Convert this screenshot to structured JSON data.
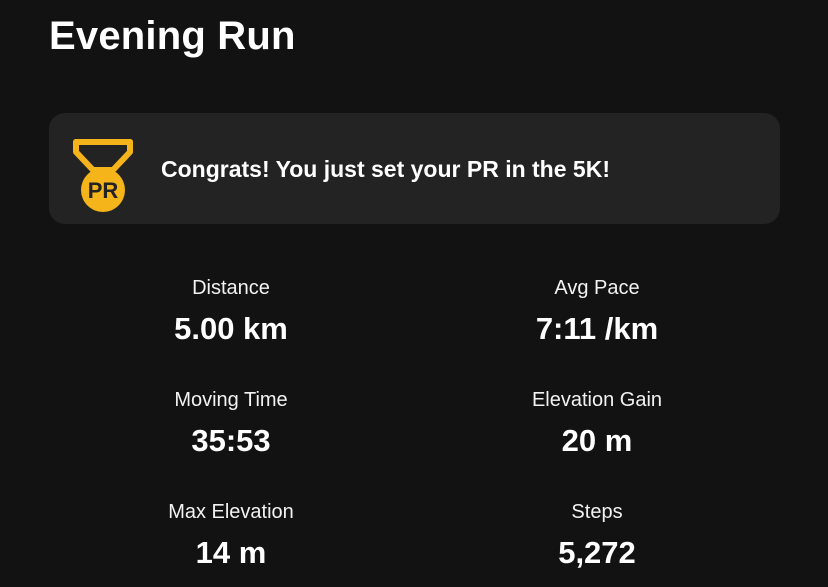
{
  "header": {
    "title": "Evening Run"
  },
  "banner": {
    "icon": "pr-medal-icon",
    "badge_text": "PR",
    "message": "Congrats! You just set your PR in the 5K!",
    "accent_color": "#f5b51a"
  },
  "stats": {
    "distance": {
      "label": "Distance",
      "value": "5.00 km"
    },
    "avg_pace": {
      "label": "Avg Pace",
      "value": "7:11 /km"
    },
    "moving_time": {
      "label": "Moving Time",
      "value": "35:53"
    },
    "elevation_gain": {
      "label": "Elevation Gain",
      "value": "20 m"
    },
    "max_elevation": {
      "label": "Max Elevation",
      "value": "14 m"
    },
    "steps": {
      "label": "Steps",
      "value": "5,272"
    }
  }
}
